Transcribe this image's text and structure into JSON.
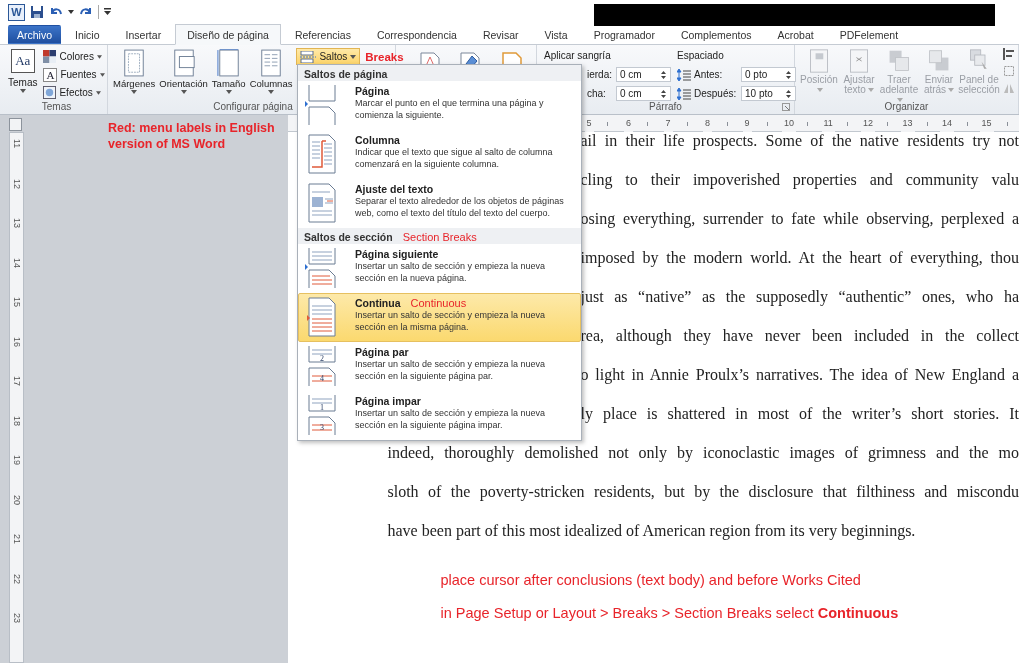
{
  "title_bar": {
    "app_icon_letter": "W"
  },
  "tabs": [
    {
      "label": "Archivo",
      "kind": "file",
      "selected": false
    },
    {
      "label": "Inicio",
      "kind": "tab",
      "selected": false
    },
    {
      "label": "Insertar",
      "kind": "tab",
      "selected": false
    },
    {
      "label": "Diseño de página",
      "kind": "tab",
      "selected": true
    },
    {
      "label": "Referencias",
      "kind": "tab",
      "selected": false
    },
    {
      "label": "Correspondencia",
      "kind": "tab",
      "selected": false
    },
    {
      "label": "Revisar",
      "kind": "tab",
      "selected": false
    },
    {
      "label": "Vista",
      "kind": "tab",
      "selected": false
    },
    {
      "label": "Programador",
      "kind": "tab",
      "selected": false
    },
    {
      "label": "Complementos",
      "kind": "tab",
      "selected": false
    },
    {
      "label": "Acrobat",
      "kind": "tab",
      "selected": false
    },
    {
      "label": "PDFelement",
      "kind": "tab",
      "selected": false
    }
  ],
  "ribbon": {
    "themes_group": {
      "label": "Temas",
      "big_button": "Temas",
      "icon_text": "Aa",
      "fonts_icon_letter": "A",
      "buttons": [
        "Colores",
        "Fuentes",
        "Efectos"
      ]
    },
    "page_setup_group": {
      "label": "Configurar página",
      "buttons": [
        "Márgenes",
        "Orientación",
        "Tamaño",
        "Columnas"
      ],
      "breaks_button": "Saltos",
      "breaks_open": true,
      "annotation": "Breaks"
    },
    "paragraph_group": {
      "label": "Párrafo",
      "indent_heading": "Aplicar sangría",
      "indent_fields": [
        {
          "label": "ierda:",
          "value": "0 cm"
        },
        {
          "label": "cha:",
          "value": "0 cm"
        }
      ],
      "spacing_heading": "Espaciado",
      "spacing_fields": [
        {
          "label": "Antes:",
          "value": "0 pto"
        },
        {
          "label": "Después:",
          "value": "10 pto"
        }
      ]
    },
    "arrange_group": {
      "label": "Organizar",
      "buttons": [
        {
          "label": "Posición",
          "disabled": true,
          "dropdown": true
        },
        {
          "label": "Ajustar texto",
          "disabled": true,
          "dropdown": true
        },
        {
          "label": "Traer adelante",
          "disabled": true,
          "dropdown": true
        },
        {
          "label": "Enviar atrás",
          "disabled": true,
          "dropdown": true
        },
        {
          "label": "Panel de selección",
          "disabled": true,
          "dropdown": false
        }
      ]
    }
  },
  "breaks_menu": {
    "sections": [
      {
        "heading": "Saltos de página",
        "items": [
          {
            "kind": "page",
            "title": "Página",
            "description": "Marcar el punto en el que termina una página y comienza la siguiente.",
            "selected": false
          },
          {
            "kind": "column",
            "title": "Columna",
            "description": "Indicar que el texto que sigue al salto de columna comenzará en la siguiente columna.",
            "selected": false
          },
          {
            "kind": "text-wrap",
            "title": "Ajuste del texto",
            "description": "Separar el texto alrededor de los objetos de páginas web, como el texto del título del texto del cuerpo.",
            "selected": false
          }
        ]
      },
      {
        "heading": "Saltos de sección",
        "annotation": "Section Breaks",
        "items": [
          {
            "kind": "next-page",
            "title": "Página siguiente",
            "description": "Insertar un salto de sección y empieza la nueva sección en la nueva página.",
            "selected": false
          },
          {
            "kind": "continuous",
            "title": "Continua",
            "annotation": "Continuous",
            "description": "Insertar un salto de sección y empieza la nueva sección en la misma página.",
            "selected": true
          },
          {
            "kind": "even-page",
            "title": "Página par",
            "page_numbers": [
              "2",
              "4"
            ],
            "description": "Insertar un salto de sección y empieza la nueva sección en la siguiente página par.",
            "selected": false
          },
          {
            "kind": "odd-page",
            "title": "Página impar",
            "page_numbers": [
              "1",
              "3"
            ],
            "description": "Insertar un salto de sección y empieza la nueva sección en la siguiente página impar.",
            "selected": false
          }
        ]
      }
    ]
  },
  "ruler": {
    "horizontal_labels": [
      "5",
      "6",
      "7",
      "8",
      "9",
      "10",
      "11",
      "12",
      "13",
      "14",
      "15"
    ],
    "vertical_labels": [
      "11",
      "12",
      "13",
      "14",
      "15",
      "16",
      "17",
      "18",
      "19",
      "20",
      "21",
      "22",
      "23"
    ]
  },
  "menu_note": "Red: menu labels in English version of MS Word",
  "document": {
    "lines": [
      {
        "text": "ail in their life prospects. Some of the native residents try not",
        "clipped_left": true
      },
      {
        "text": "cling to their impoverished properties and community valu",
        "clipped_left": true
      },
      {
        "text": "osing everything, surrender to fate while observing, perplexed a",
        "clipped_left": true
      },
      {
        "text": "imposed by the modern world. At the heart of everything, thou",
        "clipped_left": true
      },
      {
        "text": "just as “native” as the supposedly “authentic” ones, who ha",
        "clipped_left": true
      },
      {
        "text": "rea, although they have never been included in the collect",
        "clipped_left": true
      },
      {
        "text": "o light in Annie Proulx’s narratives. The idea of New England a",
        "clipped_left": true
      },
      {
        "text": "ly place is shattered in most of the writer’s short stories. It",
        "clipped_left": true
      },
      {
        "text": "indeed, thoroughly demolished not only by iconoclastic images of grimness and the mo",
        "clipped_left": false
      },
      {
        "text": "sloth of the poverty-stricken residents, but by the disclosure that filthiness and miscondu",
        "clipped_left": false
      },
      {
        "text": "have been part of this most idealized of American region from its very beginnings.",
        "clipped_left": false,
        "last": true
      }
    ],
    "instructions": [
      "place cursor after conclusions (text body) and before Works Cited",
      "in Page Setup or Layout > Breaks > Section Breaks select **Continuous**"
    ]
  }
}
